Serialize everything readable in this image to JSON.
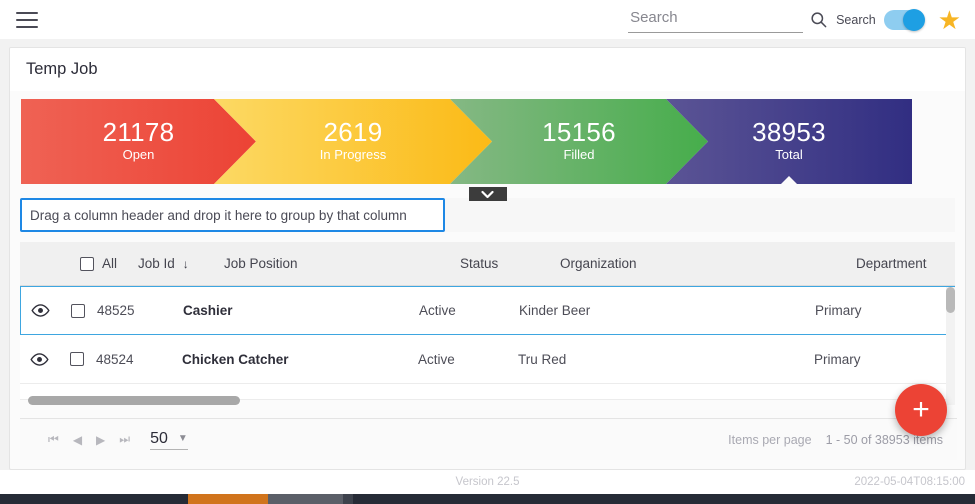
{
  "topbar": {
    "menu_icon": "hamburger-menu-icon",
    "search_placeholder": "Search",
    "search_value": "",
    "search_icon": "search-icon",
    "search_toggle_label": "Search",
    "search_toggle_on": true,
    "favorite_icon": "star-icon",
    "accent_blue": "#1e9fe3",
    "star_color": "#f7b524"
  },
  "card": {
    "title": "Temp Job",
    "collapse_icon": "chevron-down-icon"
  },
  "funnel": {
    "segments": [
      {
        "value": "21178",
        "label": "Open",
        "color": "#ec4335"
      },
      {
        "value": "2619",
        "label": "In Progress",
        "color": "#fbba16"
      },
      {
        "value": "15156",
        "label": "Filled",
        "color": "#46ad4b"
      },
      {
        "value": "38953",
        "label": "Total",
        "color": "#312e82"
      }
    ]
  },
  "groupbar": {
    "text": "Drag a column header and drop it here to group by that column",
    "border_color": "#1e88e5"
  },
  "grid": {
    "select_all_label": "All",
    "columns": [
      {
        "key": "job_id",
        "label": "Job Id",
        "sorted": "desc",
        "sort_icon": "arrow-down-icon"
      },
      {
        "key": "job_position",
        "label": "Job Position"
      },
      {
        "key": "status",
        "label": "Status"
      },
      {
        "key": "organization",
        "label": "Organization"
      },
      {
        "key": "department",
        "label": "Department"
      }
    ],
    "rows": [
      {
        "job_id": "48525",
        "job_position": "Cashier",
        "status": "Active",
        "organization": "Kinder Beer",
        "department": "Primary",
        "focused": true,
        "view_icon": "eye-icon"
      },
      {
        "job_id": "48524",
        "job_position": "Chicken Catcher",
        "status": "Active",
        "organization": "Tru Red",
        "department": "Primary",
        "focused": false,
        "view_icon": "eye-icon"
      }
    ]
  },
  "fab": {
    "label": "+",
    "icon": "plus-icon",
    "color": "#ec4335"
  },
  "pager": {
    "first_icon": "page-first-icon",
    "prev_icon": "page-prev-icon",
    "next_icon": "page-next-icon",
    "last_icon": "page-last-icon",
    "page_size": "50",
    "page_size_caret": "chevron-down-icon",
    "items_per_page_label": "Items per page",
    "range_label": "1 - 50 of 38953 items"
  },
  "footer": {
    "version": "Version 22.5",
    "timestamp": "2022-05-04T08:15:00"
  }
}
